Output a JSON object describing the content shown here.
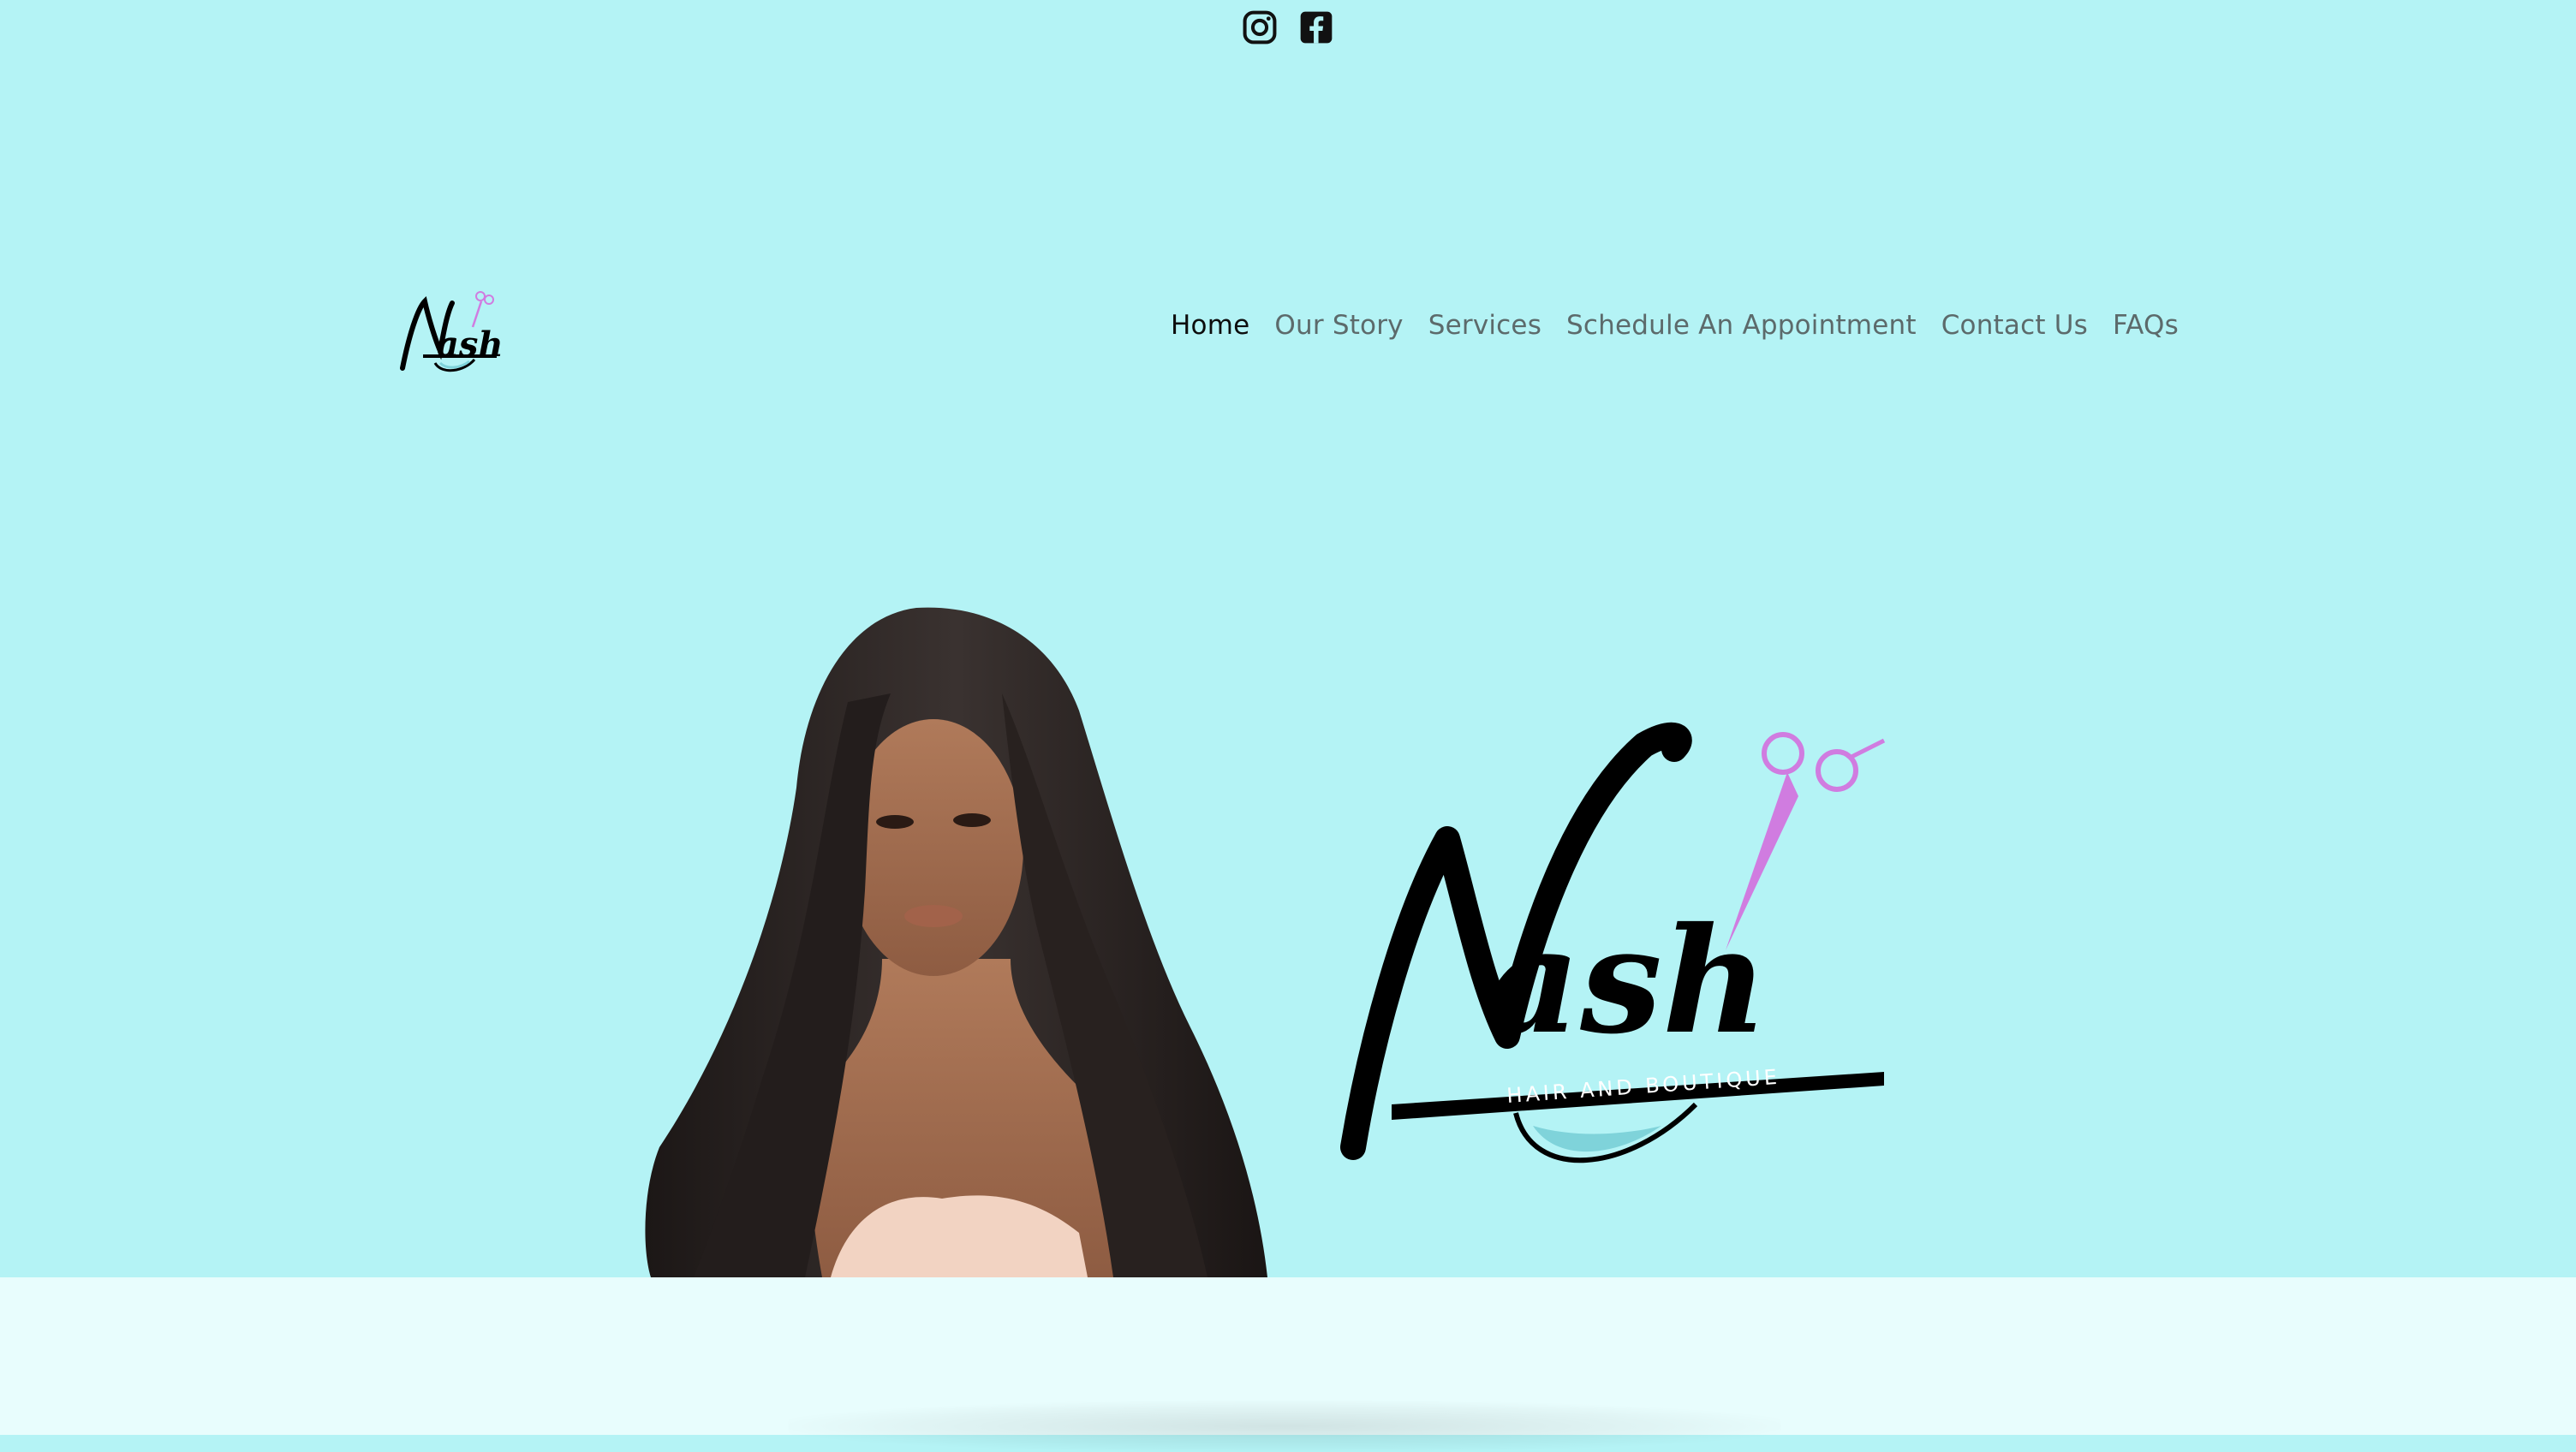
{
  "social": {
    "instagram_icon": "instagram-icon",
    "facebook_icon": "facebook-icon"
  },
  "header": {
    "logo_text": "Nash"
  },
  "nav": {
    "items": [
      {
        "label": "Home",
        "active": true
      },
      {
        "label": "Our Story",
        "active": false
      },
      {
        "label": "Services",
        "active": false
      },
      {
        "label": "Schedule An Appointment",
        "active": false
      },
      {
        "label": "Contact Us",
        "active": false
      },
      {
        "label": "FAQs",
        "active": false
      }
    ]
  },
  "hero": {
    "logo_text": "Nash",
    "logo_tagline": "HAIR AND BOUTIQUE"
  },
  "colors": {
    "hero_background": "#b4f3f5",
    "lower_background": "#e8fdfd",
    "accent_pink": "#d07ce0",
    "accent_teal": "#7fd3da",
    "nav_text": "#5c6a6b",
    "nav_active": "#0d0d0d"
  }
}
